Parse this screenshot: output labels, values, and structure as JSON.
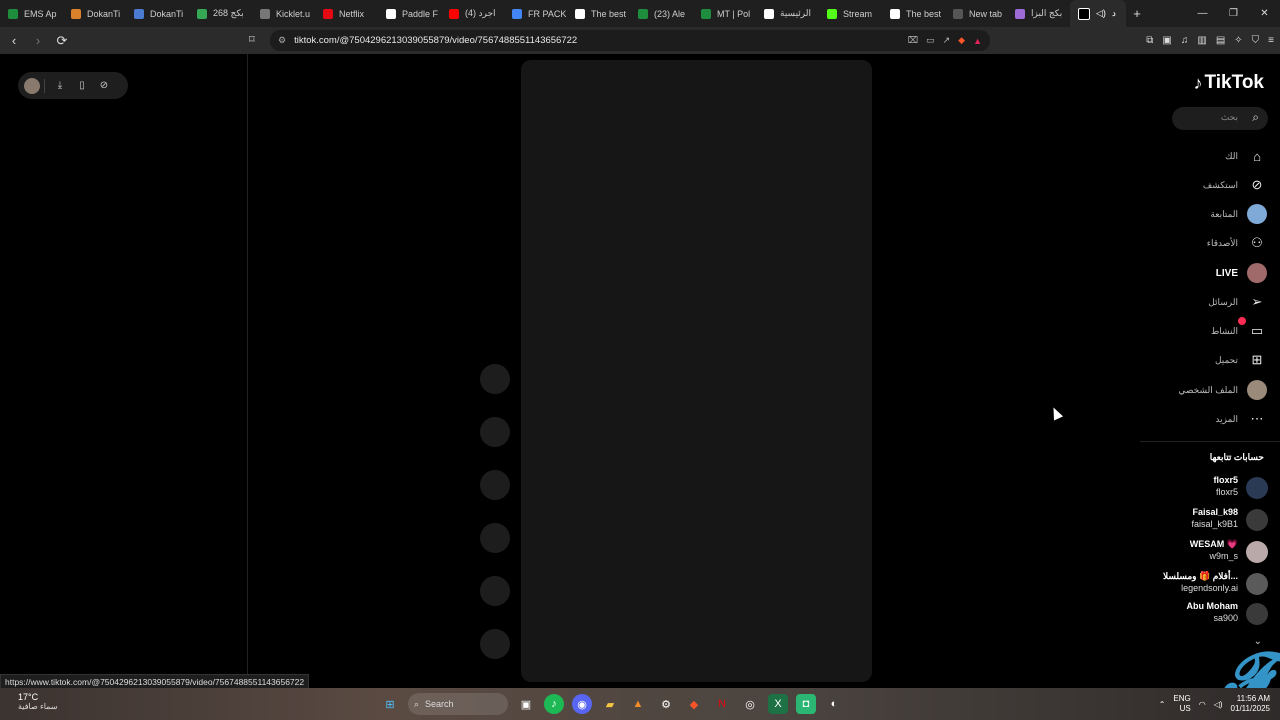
{
  "browser": {
    "tabs": [
      {
        "title": "EMS Ap",
        "color": "#1e8e3e"
      },
      {
        "title": "DokanTi",
        "color": "#d9822b"
      },
      {
        "title": "DokanTi",
        "color": "#4a7bd0"
      },
      {
        "title": "268 بكج",
        "color": "#34a853"
      },
      {
        "title": "Kicklet.u",
        "color": "#777777"
      },
      {
        "title": "Netflix",
        "color": "#e50914"
      },
      {
        "title": "Paddle F",
        "color": "#ffffff"
      },
      {
        "title": "(4) اجرد",
        "color": "#ff0000"
      },
      {
        "title": "FR PACK",
        "color": "#4285f4"
      },
      {
        "title": "The best",
        "color": "#ffffff"
      },
      {
        "title": "(23) Ale",
        "color": "#1e8e3e"
      },
      {
        "title": "MT | Pol",
        "color": "#1e8e3e"
      },
      {
        "title": "الرئيسية",
        "color": "#ffffff"
      },
      {
        "title": "Stream",
        "color": "#53fc18"
      },
      {
        "title": "The best",
        "color": "#ffffff"
      },
      {
        "title": "New tab",
        "color": "#555555"
      },
      {
        "title": "بكج البزا",
        "color": "#9c6bd6"
      }
    ],
    "active_tab": {
      "title": "د",
      "close": "✕"
    },
    "new_tab": "+",
    "url": "tiktok.com/@7504296213039055879/video/7567488551143656722",
    "status_url": "https://www.tiktok.com/@7504296213039055879/video/7567488551143656722"
  },
  "tiktok": {
    "logo": "TikTok",
    "search_placeholder": "بحث",
    "nav": [
      {
        "label": "الك",
        "icon": "home-icon"
      },
      {
        "label": "استكشف",
        "icon": "explore-icon"
      },
      {
        "label": "المتابعة",
        "icon": "following-icon"
      },
      {
        "label": "الأصدقاء",
        "icon": "friends-icon"
      },
      {
        "label": "LIVE",
        "icon": "live-icon"
      },
      {
        "label": "الرسائل",
        "icon": "messages-icon"
      },
      {
        "label": "النشاط",
        "icon": "activity-icon"
      },
      {
        "label": "تحميل",
        "icon": "upload-icon"
      },
      {
        "label": "الملف الشخصي",
        "icon": "profile-icon"
      },
      {
        "label": "المزيد",
        "icon": "more-icon"
      }
    ],
    "following_title": "حسابات تتابعها",
    "accounts": [
      {
        "name": "floxr5",
        "handle": "floxr5",
        "color": "#2a3a55"
      },
      {
        "name": "Faisal_k98",
        "handle": "faisal_k9B1",
        "color": "#3a3a3a"
      },
      {
        "name": "WESAM 💗",
        "handle": "w9m_s",
        "color": "#b9a9a9"
      },
      {
        "name": "أفلام 🎁 ومسلسلا...",
        "handle": "legendsonly.ai",
        "color": "#5a5a5a"
      },
      {
        "name": "Abu Moham",
        "handle": "sa900",
        "color": "#3a3a3a"
      }
    ],
    "watermark": "F"
  },
  "taskbar": {
    "temperature": "17°C",
    "condition": "سماء صافية",
    "search": "Search",
    "lang": "ENG",
    "region": "US",
    "time": "11:56 AM",
    "date": "01/11/2025"
  }
}
